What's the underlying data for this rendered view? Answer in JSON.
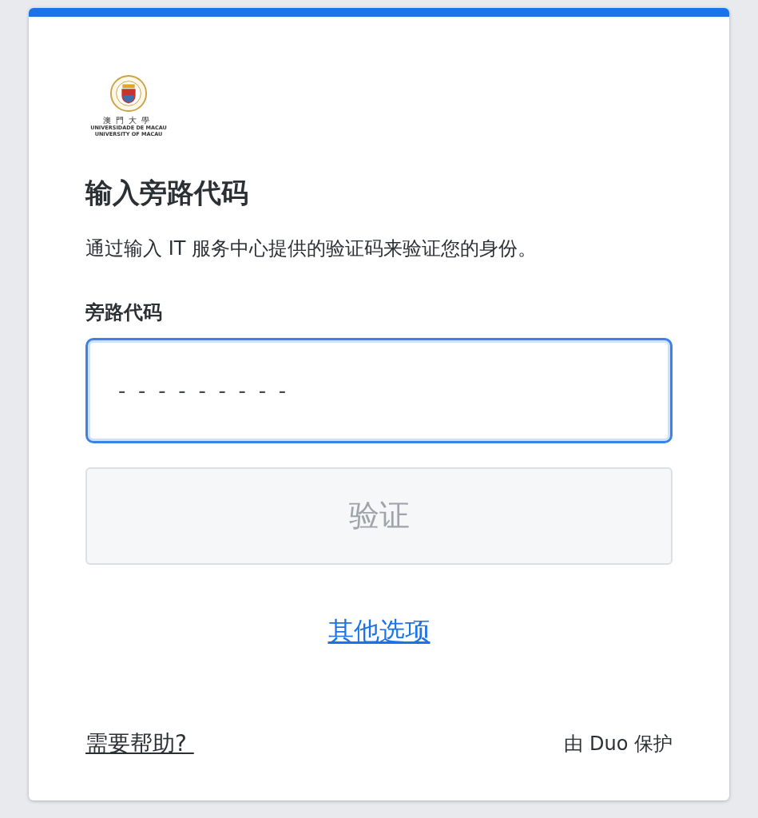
{
  "logo": {
    "chinese": "澳門大學",
    "portuguese": "UNIVERSIDADE DE MACAU",
    "english": "UNIVERSITY OF MACAU"
  },
  "title": "输入旁路代码",
  "description": "通过输入 IT 服务中心提供的验证码来验证您的身份。",
  "field": {
    "label": "旁路代码",
    "placeholder": "- - - - - - - - -",
    "focused": true
  },
  "submit": {
    "label": "验证",
    "disabled": true
  },
  "other_options": "其他选项",
  "footer": {
    "help": "需要帮助? ",
    "protected_by": "由 Duo 保护"
  }
}
